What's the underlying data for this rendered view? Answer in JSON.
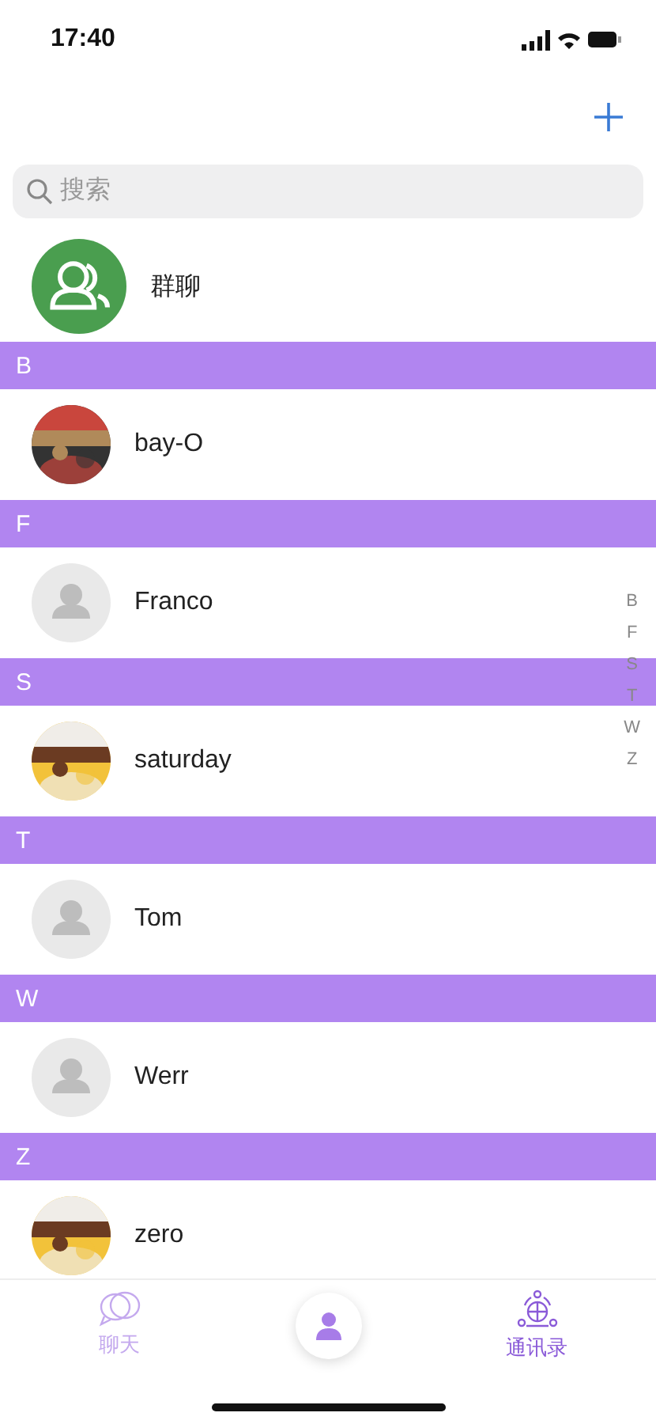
{
  "status_bar": {
    "time": "17:40"
  },
  "search": {
    "placeholder": "搜索"
  },
  "group_chat": {
    "label": "群聊"
  },
  "sections": [
    {
      "letter": "B",
      "contacts": [
        {
          "name": "bay-O"
        }
      ]
    },
    {
      "letter": "F",
      "contacts": [
        {
          "name": "Franco",
          "kind": "default"
        }
      ]
    },
    {
      "letter": "S",
      "contacts": [
        {
          "name": "saturday"
        }
      ]
    },
    {
      "letter": "T",
      "contacts": [
        {
          "name": "Tom",
          "kind": "default"
        }
      ]
    },
    {
      "letter": "W",
      "contacts": [
        {
          "name": "Werr",
          "kind": "default"
        }
      ]
    },
    {
      "letter": "Z",
      "contacts": [
        {
          "name": "zero"
        }
      ]
    }
  ],
  "index": [
    "B",
    "F",
    "S",
    "T",
    "W",
    "Z"
  ],
  "tab_bar": [
    {
      "label": "聊天",
      "kind": "chat",
      "selected": false
    },
    {
      "kind": "center"
    },
    {
      "label": "通讯录",
      "kind": "contacts",
      "selected": true
    }
  ]
}
